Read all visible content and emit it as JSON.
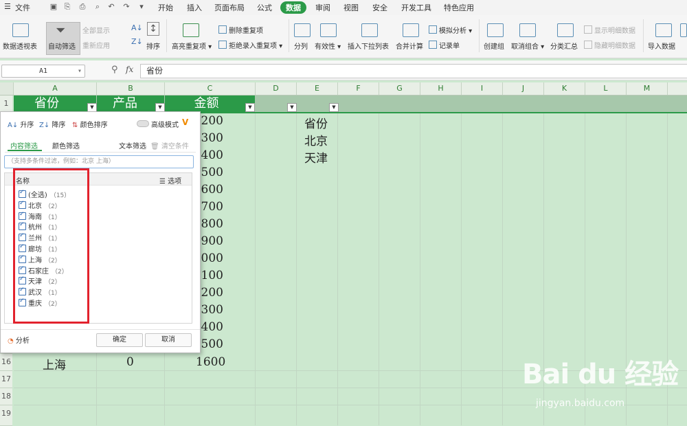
{
  "menubar": {
    "file": "文件",
    "tabs": [
      "开始",
      "插入",
      "页面布局",
      "公式",
      "数据",
      "审阅",
      "视图",
      "安全",
      "开发工具",
      "特色应用"
    ],
    "active_tab": "数据"
  },
  "ribbon": {
    "pivot": "数据透视表",
    "autofilter": "自动筛选",
    "show_all": "全部显示",
    "reapply": "重新应用",
    "sort": "排序",
    "highlight_dup": "高亮重复项",
    "delete_dup": "删除重复项",
    "reject_dup": "拒绝录入重复项",
    "split": "分列",
    "validity": "有效性",
    "insert_dropdown": "插入下拉列表",
    "consolidate": "合并计算",
    "simulate": "模拟分析",
    "record": "记录单",
    "create_group": "创建组",
    "ungroup": "取消组合",
    "subtotal": "分类汇总",
    "show_detail": "显示明细数据",
    "hide_detail": "隐藏明细数据",
    "import": "导入数据"
  },
  "formula_bar": {
    "cell_ref": "A1",
    "fx": "fx",
    "content": "省份"
  },
  "grid": {
    "columns": [
      "A",
      "B",
      "C",
      "D",
      "E",
      "F",
      "G",
      "H",
      "I",
      "J",
      "K",
      "L",
      "M"
    ],
    "rows_visible": [
      "1",
      "16",
      "17",
      "18",
      "19"
    ],
    "headers": {
      "a": "省份",
      "b": "产品",
      "c": "金额"
    },
    "amounts": [
      "200",
      "300",
      "400",
      "500",
      "600",
      "700",
      "800",
      "900",
      "1000",
      "1100",
      "1200",
      "1300",
      "1400",
      "1500",
      "1600"
    ],
    "row16": {
      "province": "上海",
      "product": "0",
      "amount": "1600"
    },
    "e_column": [
      "省份",
      "北京",
      "天津"
    ]
  },
  "filter_dialog": {
    "sort_asc": "升序",
    "sort_desc": "降序",
    "color_sort": "颜色排序",
    "advanced": "高级模式",
    "tab_content": "内容筛选",
    "tab_color": "颜色筛选",
    "text_filter": "文本筛选",
    "clear": "清空条件",
    "search_placeholder": "（支持多条件过滤，例如：北京  上海）",
    "list_header": "名称",
    "options": "选项",
    "items": [
      {
        "label": "(全选)",
        "count": "（15）"
      },
      {
        "label": "北京",
        "count": "（2）"
      },
      {
        "label": "海南",
        "count": "（1）"
      },
      {
        "label": "杭州",
        "count": "（1）"
      },
      {
        "label": "兰州",
        "count": "（1）"
      },
      {
        "label": "廊坊",
        "count": "（1）"
      },
      {
        "label": "上海",
        "count": "（2）"
      },
      {
        "label": "石家庄",
        "count": "（2）"
      },
      {
        "label": "天津",
        "count": "（2）"
      },
      {
        "label": "武汉",
        "count": "（1）"
      },
      {
        "label": "重庆",
        "count": "（2）"
      }
    ],
    "analyze": "分析",
    "ok": "确定",
    "cancel": "取消"
  },
  "watermark": {
    "logo": "Bai du 经验",
    "url": "jingyan.baidu.com"
  },
  "colors": {
    "accent": "#2b9a48",
    "sheet_bg": "#cce8cf",
    "highlight": "#e2222d"
  }
}
